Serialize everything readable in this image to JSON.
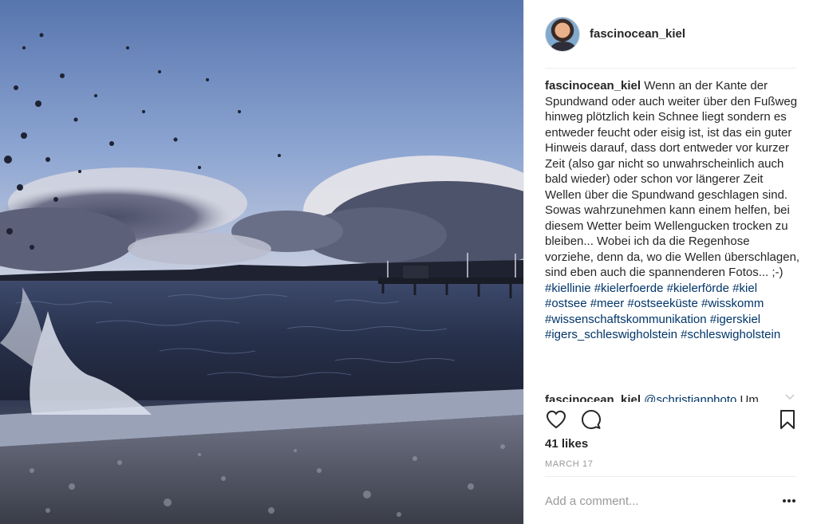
{
  "post": {
    "username": "fascinocean_kiel",
    "caption_user": "fascinocean_kiel",
    "caption_text": "Wenn an der Kante der Spundwand oder auch weiter über den Fußweg hinweg plötzlich kein Schnee liegt sondern es entweder feucht oder eisig ist, ist das ein guter Hinweis darauf, dass dort entweder vor kurzer Zeit (also gar nicht so unwahrscheinlich auch bald wieder) oder schon vor längerer Zeit Wellen über die Spundwand geschlagen sind. Sowas wahrzunehmen kann einem helfen, bei diesem Wetter beim Wellengucken trocken zu bleiben... Wobei ich da die Regenhose vorziehe, denn da, wo die Wellen überschlagen, sind eben auch die spannenderen Fotos... ;-) ",
    "hashtags": [
      "#kiellinie",
      "#kielerfoerde",
      "#kielerförde",
      "#kiel",
      "#ostsee",
      "#meer",
      "#ostseeküste",
      "#wisskomm",
      "#wissenschaftskommunikation",
      "#igerskiel",
      "#igers_schleswigholstein",
      "#schleswigholstein"
    ],
    "reply_user": "fascinocean_kiel",
    "reply_mention": "@schristianphoto",
    "reply_text": " Um",
    "likes": "41 likes",
    "date": "MARCH 17",
    "comment_placeholder": "Add a comment..."
  },
  "icons": {
    "like": "heart-outline",
    "comment": "speech-bubble",
    "save": "bookmark-outline",
    "more": "ellipsis-horizontal",
    "expand": "chevron-down"
  },
  "colors": {
    "text": "#262626",
    "hashtag": "#003569",
    "muted": "#999999",
    "divider": "#efefef"
  }
}
